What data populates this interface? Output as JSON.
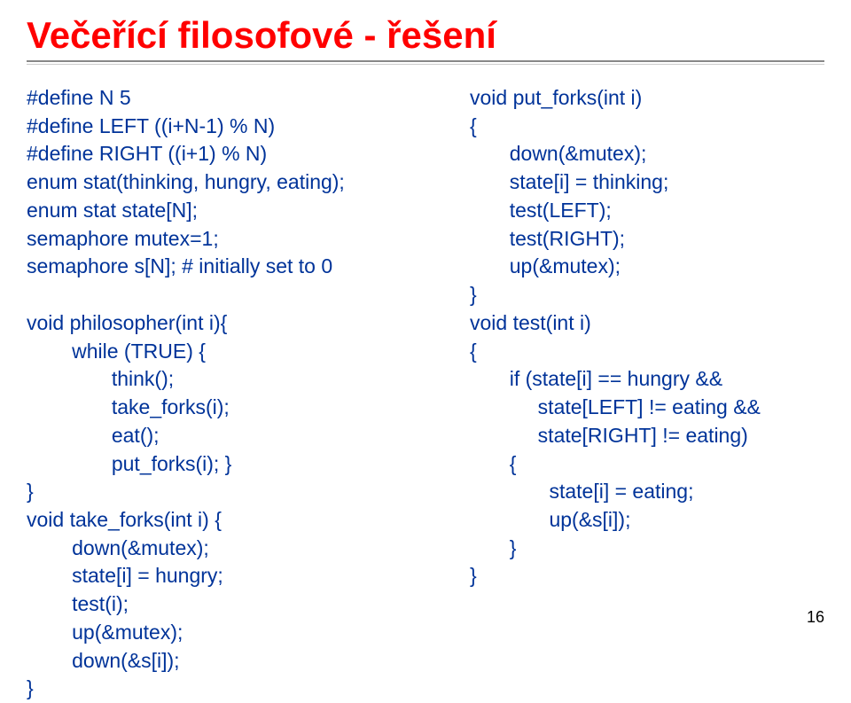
{
  "title": "Večeřící filosofové - řešení",
  "left_code": "#define N 5\n#define LEFT ((i+N-1) % N)\n#define RIGHT ((i+1) % N)\nenum stat(thinking, hungry, eating);\nenum stat state[N];\nsemaphore mutex=1;\nsemaphore s[N]; # initially set to 0\n\nvoid philosopher(int i){\n        while (TRUE) {\n               think();\n               take_forks(i);\n               eat();\n               put_forks(i); }\n}\nvoid take_forks(int i) {\n        down(&mutex);\n        state[i] = hungry;\n        test(i);\n        up(&mutex);\n        down(&s[i]);\n}",
  "right_code": "void put_forks(int i)\n{\n       down(&mutex);\n       state[i] = thinking;\n       test(LEFT);\n       test(RIGHT);\n       up(&mutex);\n}\nvoid test(int i)\n{\n       if (state[i] == hungry &&\n            state[LEFT] != eating &&\n            state[RIGHT] != eating)\n       {\n              state[i] = eating;\n              up(&s[i]);\n       }\n}",
  "page_number": "16"
}
